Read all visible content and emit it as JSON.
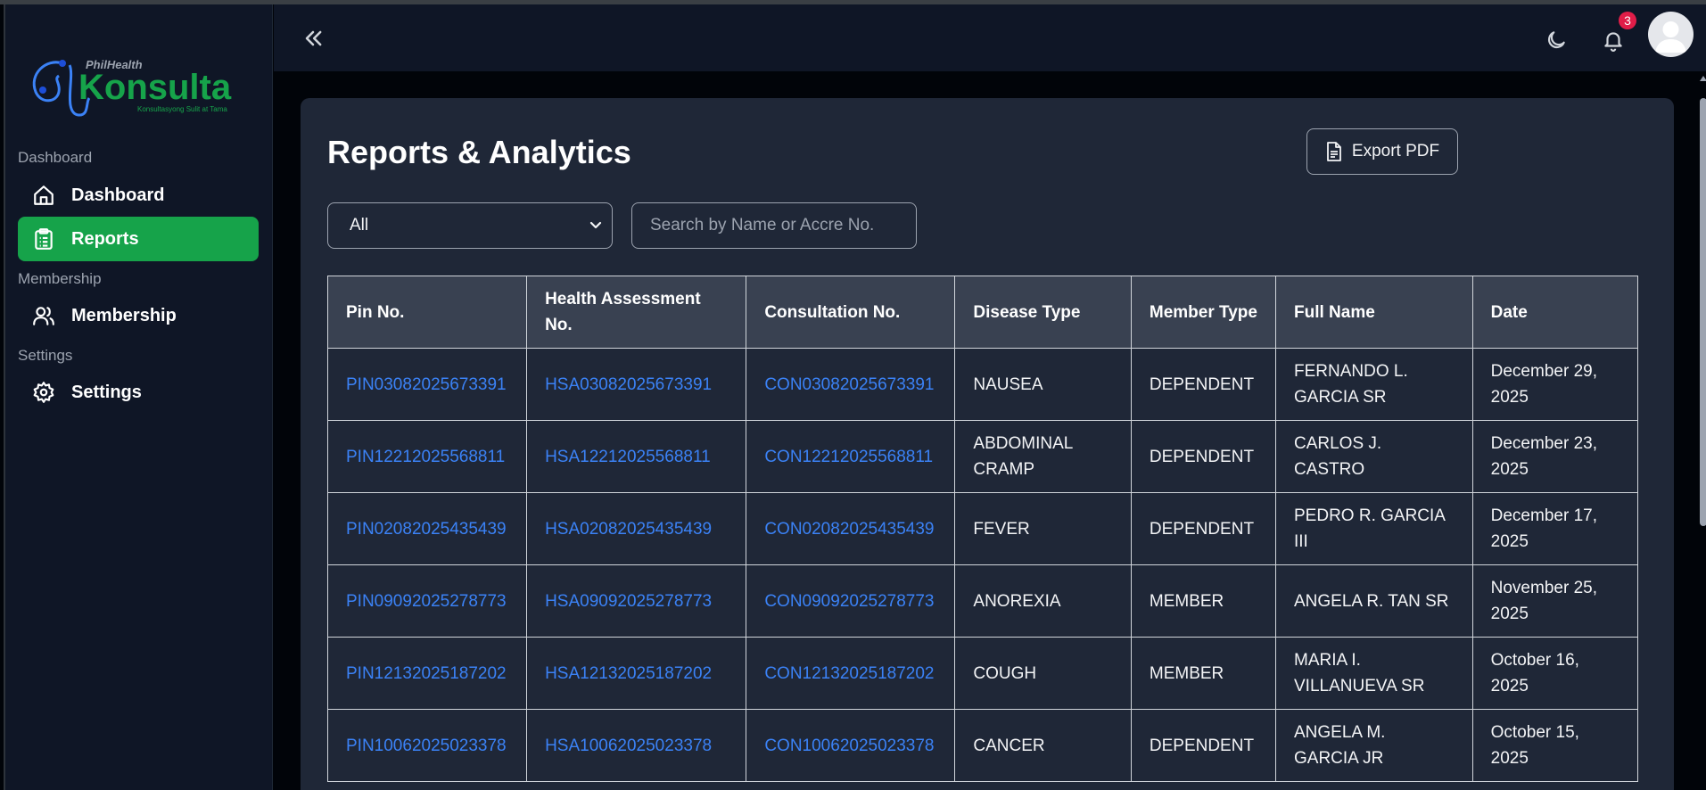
{
  "app": {
    "logo_text": "Konsulta",
    "logo_super": "PhilHealth",
    "logo_tagline": "Konsultasyong Sulit at Tama"
  },
  "sidebar": {
    "sections": [
      {
        "label": "Dashboard",
        "items": [
          {
            "label": "Dashboard",
            "icon": "home-icon",
            "active": false
          },
          {
            "label": "Reports",
            "icon": "clipboard-icon",
            "active": true
          }
        ]
      },
      {
        "label": "Membership",
        "items": [
          {
            "label": "Membership",
            "icon": "users-icon",
            "active": false
          }
        ]
      },
      {
        "label": "Settings",
        "items": [
          {
            "label": "Settings",
            "icon": "gear-icon",
            "active": false
          }
        ]
      }
    ]
  },
  "header": {
    "notification_count": "3",
    "icons": [
      "chevrons-left-icon",
      "moon-icon",
      "bell-icon",
      "avatar-icon"
    ]
  },
  "main": {
    "title": "Reports & Analytics",
    "export_label": "Export PDF",
    "filter": {
      "selected": "All"
    },
    "search": {
      "placeholder": "Search by Name or Accre No.",
      "value": ""
    }
  },
  "table": {
    "columns": [
      "Pin No.",
      "Health Assessment No.",
      "Consultation No.",
      "Disease Type",
      "Member Type",
      "Full Name",
      "Date"
    ],
    "rows": [
      [
        "PIN03082025673391",
        "HSA03082025673391",
        "CON03082025673391",
        "NAUSEA",
        "DEPENDENT",
        "FERNANDO L. GARCIA SR",
        "December 29, 2025"
      ],
      [
        "PIN12212025568811",
        "HSA12212025568811",
        "CON12212025568811",
        "ABDOMINAL CRAMP",
        "DEPENDENT",
        "CARLOS J. CASTRO",
        "December 23, 2025"
      ],
      [
        "PIN02082025435439",
        "HSA02082025435439",
        "CON02082025435439",
        "FEVER",
        "DEPENDENT",
        "PEDRO R. GARCIA III",
        "December 17, 2025"
      ],
      [
        "PIN09092025278773",
        "HSA09092025278773",
        "CON09092025278773",
        "ANOREXIA",
        "MEMBER",
        "ANGELA R. TAN SR",
        "November 25, 2025"
      ],
      [
        "PIN12132025187202",
        "HSA12132025187202",
        "CON12132025187202",
        "COUGH",
        "MEMBER",
        "MARIA I. VILLANUEVA SR",
        "October 16, 2025"
      ],
      [
        "PIN10062025023378",
        "HSA10062025023378",
        "CON10062025023378",
        "CANCER",
        "DEPENDENT",
        "ANGELA M. GARCIA JR",
        "October 15, 2025"
      ]
    ]
  },
  "colors": {
    "accent": "#16a34a",
    "link": "#3b82f6",
    "badge": "#e11d48",
    "card": "#1f2737",
    "sidebar": "#0f1626"
  }
}
